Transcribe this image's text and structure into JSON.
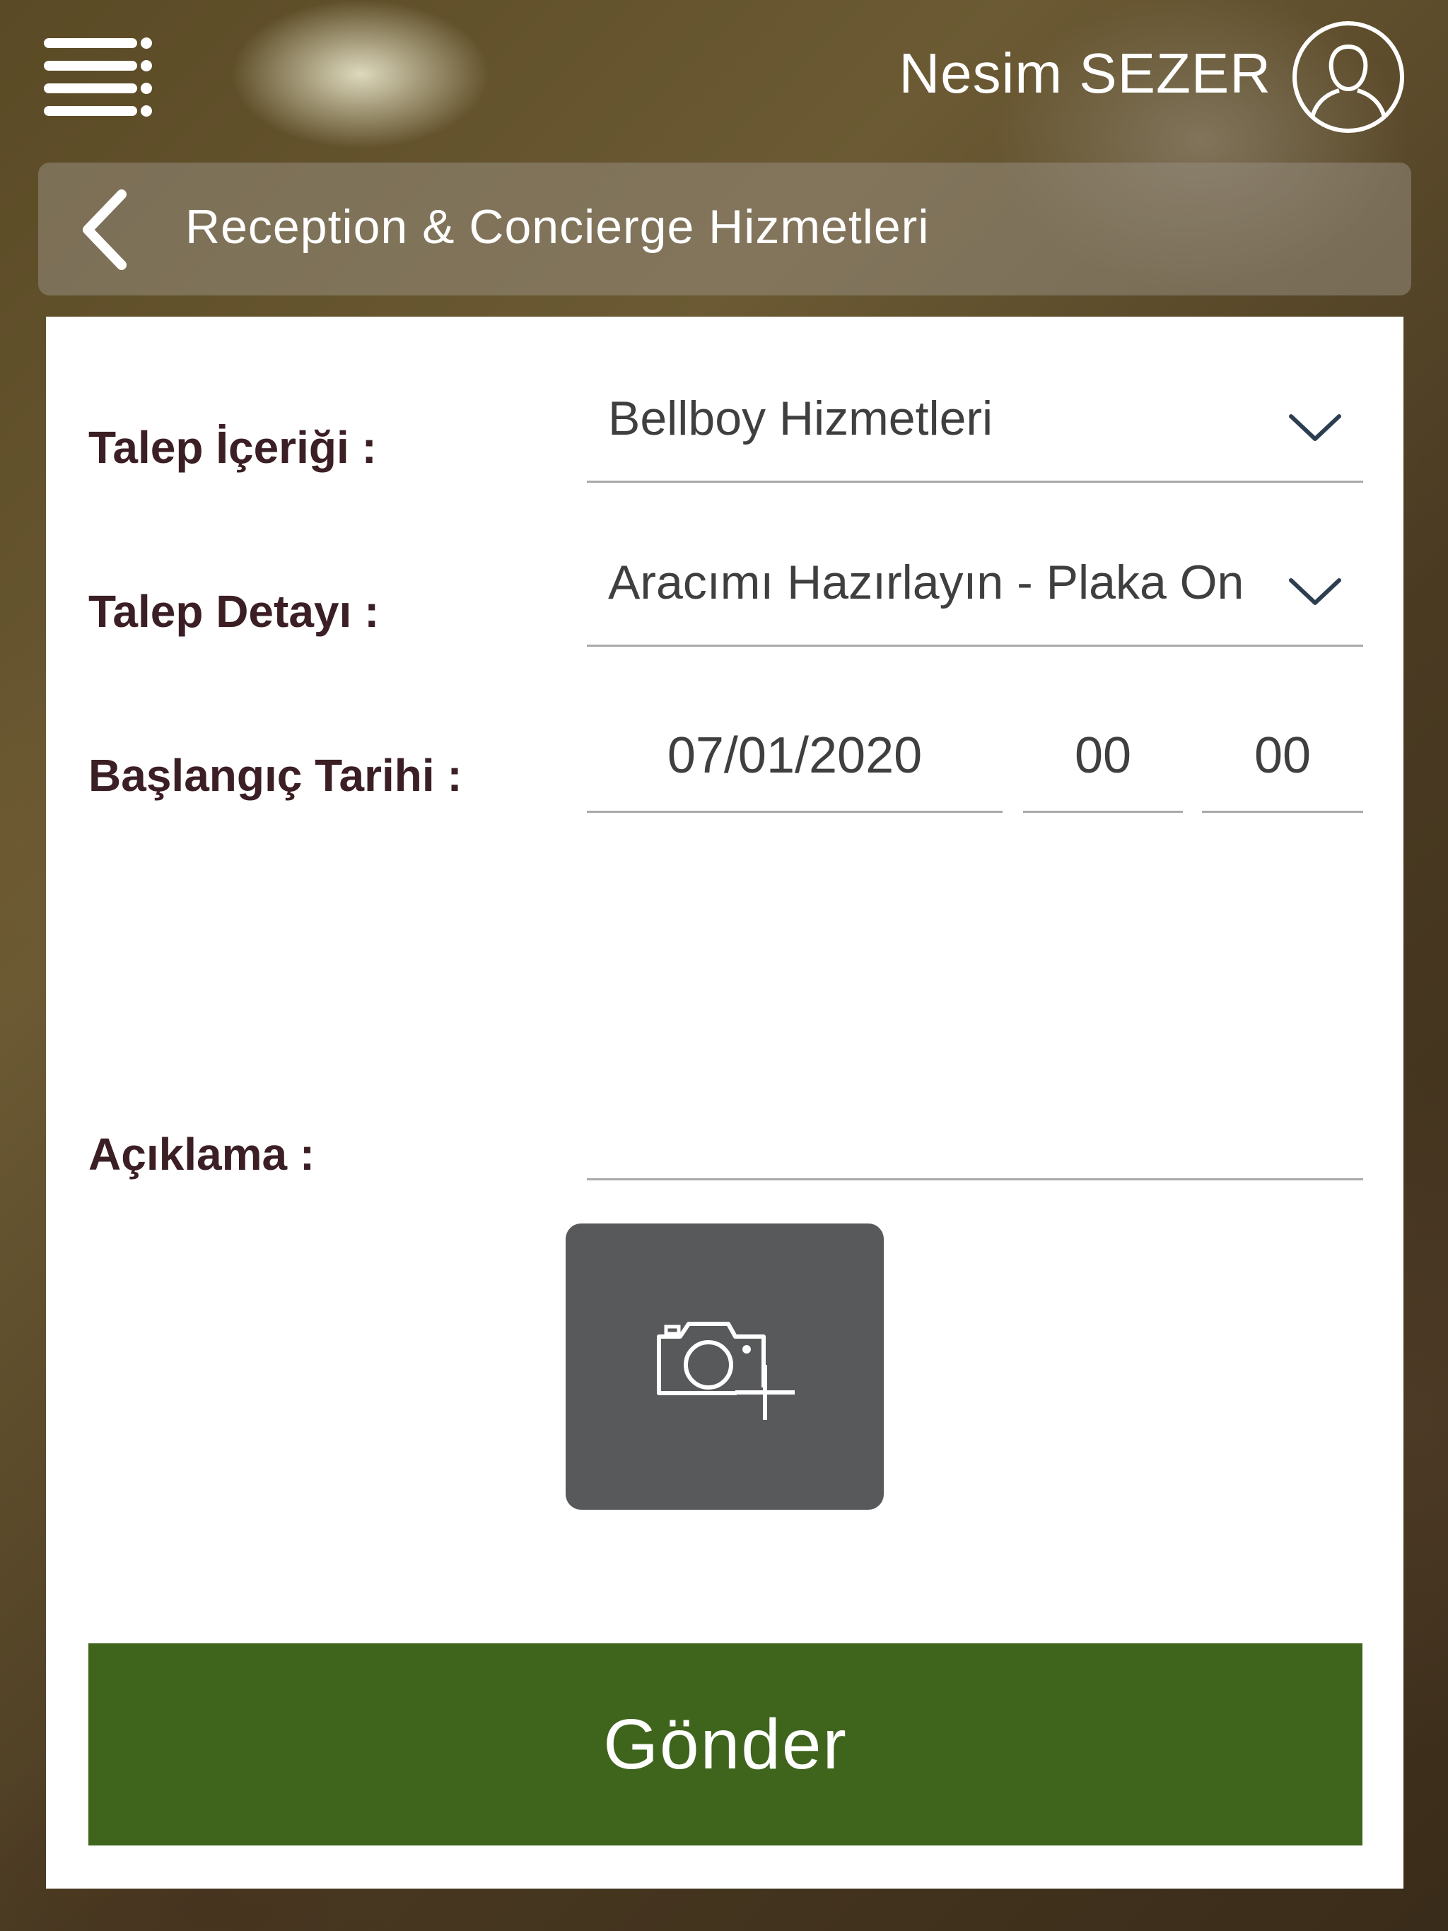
{
  "header": {
    "user_name": "Nesim SEZER",
    "menu_icon": "hamburger-menu-icon",
    "avatar_icon": "user-avatar-icon"
  },
  "title_bar": {
    "back_icon": "chevron-left-icon",
    "title": "Reception & Concierge Hizmetleri"
  },
  "form": {
    "request_content": {
      "label": "Talep İçeriği :",
      "value": "Bellboy Hizmetleri"
    },
    "request_detail": {
      "label": "Talep Detayı :",
      "value": "Aracımı Hazırlayın - Plaka On"
    },
    "start_date": {
      "label": "Başlangıç Tarihi :",
      "date": "07/01/2020",
      "hour": "00",
      "minute": "00"
    },
    "description": {
      "label": "Açıklama :",
      "value": ""
    },
    "add_photo_icon": "camera-plus-icon",
    "submit_label": "Gönder"
  },
  "colors": {
    "submit_button": "#3f651d",
    "label_text": "#3b1f24",
    "camera_button": "#58595b"
  }
}
